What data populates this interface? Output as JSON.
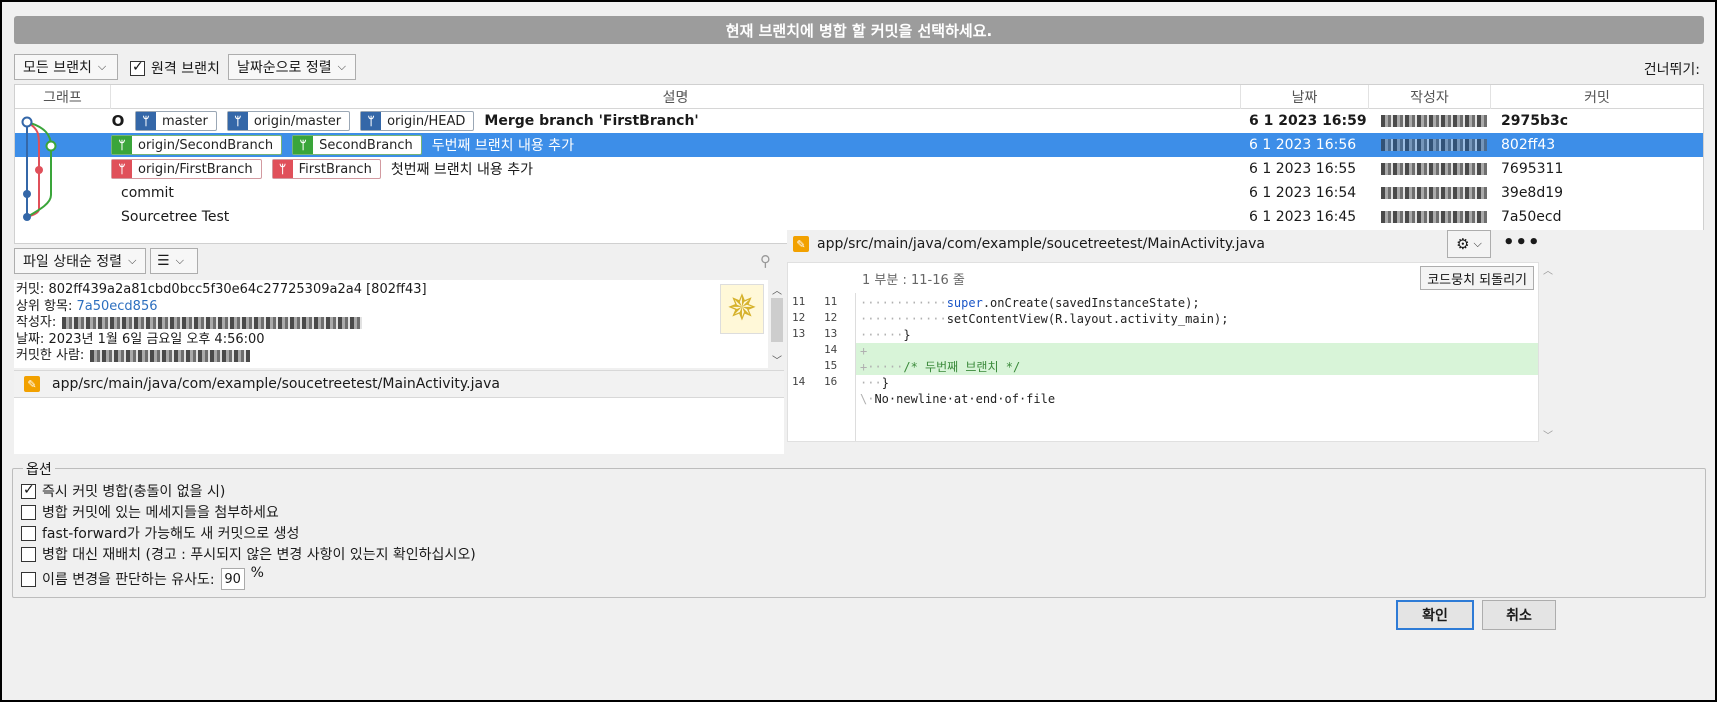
{
  "dialog_title": "현재 브랜치에 병합 할 커밋을 선택하세요.",
  "toolbar": {
    "branches_dropdown": "모든 브랜치",
    "remote_branches_label": "원격 브랜치",
    "remote_branches_checked": true,
    "sort_dropdown": "날짜순으로 정렬",
    "skip_label": "건너뛰기:"
  },
  "table": {
    "headers": {
      "graph": "그래프",
      "description": "설명",
      "date": "날짜",
      "author": "작성자",
      "commit": "커밋"
    },
    "rows": [
      {
        "head_marker": "O",
        "tags": [
          {
            "label": "master",
            "color": "blue"
          },
          {
            "label": "origin/master",
            "color": "blue"
          },
          {
            "label": "origin/HEAD",
            "color": "blue"
          }
        ],
        "message": "Merge branch 'FirstBranch'",
        "date": "6 1 2023 16:59",
        "hash": "2975b3c",
        "bold": true,
        "selected": false
      },
      {
        "head_marker": "",
        "tags": [
          {
            "label": "origin/SecondBranch",
            "color": "green"
          },
          {
            "label": "SecondBranch",
            "color": "green"
          }
        ],
        "message": "두번째 브랜치 내용 추가",
        "date": "6 1 2023 16:56",
        "hash": "802ff43",
        "bold": false,
        "selected": true
      },
      {
        "head_marker": "",
        "tags": [
          {
            "label": "origin/FirstBranch",
            "color": "red"
          },
          {
            "label": "FirstBranch",
            "color": "red"
          }
        ],
        "message": "첫번째 브랜치 내용 추가",
        "date": "6 1 2023 16:55",
        "hash": "7695311",
        "bold": false,
        "selected": false
      },
      {
        "head_marker": "",
        "tags": [],
        "message": "commit",
        "date": "6 1 2023 16:54",
        "hash": "39e8d19",
        "bold": false,
        "selected": false
      },
      {
        "head_marker": "",
        "tags": [],
        "message": "Sourcetree Test",
        "date": "6 1 2023 16:45",
        "hash": "7a50ecd",
        "bold": false,
        "selected": false
      }
    ]
  },
  "left_panel": {
    "sort_dropdown": "파일 상태순 정렬",
    "view_icon": "list-icon",
    "commit_info": {
      "commit_label": "커밋:",
      "commit_value": "802ff439a2a81cbd0bcc5f30e64c27725309a2a4 [802ff43]",
      "parent_label": "상위 항목:",
      "parent_value": "7a50ecd856",
      "author_label": "작성자:",
      "date_label": "날짜:",
      "date_value": "2023년 1월 6일 금요일 오후 4:56:00",
      "committer_label": "커밋한 사람:"
    },
    "file": "app/src/main/java/com/example/soucetreetest/MainActivity.java"
  },
  "diff": {
    "file_path": "app/src/main/java/com/example/soucetreetest/MainActivity.java",
    "hunk_label": "1 부분 : 11-16 줄",
    "revert_button": "코드뭉치 되돌리기",
    "lines": [
      {
        "old": "11",
        "new": "11",
        "type": "ctx",
        "dots": "············",
        "kw": "super",
        "rest": ".onCreate(savedInstanceState);"
      },
      {
        "old": "12",
        "new": "12",
        "type": "ctx",
        "dots": "············",
        "kw": "",
        "rest": "setContentView(R.layout.activity_main);"
      },
      {
        "old": "13",
        "new": "13",
        "type": "ctx",
        "dots": "······",
        "kw": "",
        "rest": "}"
      },
      {
        "old": "",
        "new": "14",
        "type": "add",
        "dots": "+",
        "kw": "",
        "rest": ""
      },
      {
        "old": "",
        "new": "15",
        "type": "add",
        "dots": "+·····",
        "kw": "",
        "rest": "/* 두번째 브랜치 */"
      },
      {
        "old": "14",
        "new": "16",
        "type": "ctx",
        "dots": "···",
        "kw": "",
        "rest": "}"
      },
      {
        "old": "",
        "new": "",
        "type": "ctx",
        "dots": "\\·",
        "kw": "",
        "rest": "No·newline·at·end·of·file"
      }
    ]
  },
  "options": {
    "title": "옵션",
    "items": [
      {
        "label": "즉시 커밋 병합(충돌이 없을 시)",
        "checked": true
      },
      {
        "label": "병합 커밋에 있는 메세지들을 첨부하세요",
        "checked": false
      },
      {
        "label": "fast-forward가 가능해도 새 커밋으로 생성",
        "checked": false
      },
      {
        "label": "병합 대신 재배치 (경고 : 푸시되지 않은 변경 사항이 있는지 확인하십시오)",
        "checked": false
      }
    ],
    "similarity_label": "이름 변경을 판단하는 유사도:",
    "similarity_value": "90",
    "similarity_unit": "%"
  },
  "buttons": {
    "ok": "확인",
    "cancel": "취소"
  },
  "colors": {
    "selection": "#3d8ee8",
    "graph_blue": "#3467a8",
    "graph_green": "#3aa53a",
    "graph_red": "#e0505a"
  }
}
